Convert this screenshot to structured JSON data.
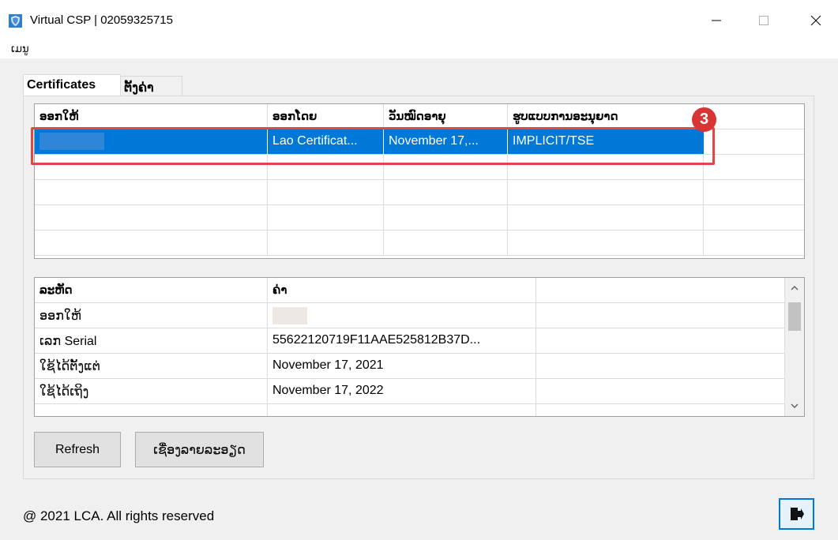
{
  "window": {
    "title": "Virtual CSP | 02059325715",
    "minimize_icon": "minimize-icon",
    "maximize_icon": "maximize-icon",
    "close_icon": "close-icon"
  },
  "menu": {
    "items": [
      {
        "label": "ເມນູ"
      }
    ]
  },
  "tabs": [
    {
      "label": "Certificates",
      "active": true
    },
    {
      "label": "ຕັ້ງຄ່າ",
      "active": false
    }
  ],
  "certificates_table": {
    "columns": [
      "ອອກໃຫ້",
      "ອອກໂດຍ",
      "ວັນໝົດອາຍຸ",
      "ຮູບແບບການອະນຸຍາດ"
    ],
    "rows": [
      {
        "issued_to": "",
        "issued_by": "Lao Certificat...",
        "expires": "November 17,...",
        "license": "IMPLICIT/TSE",
        "selected": true
      }
    ],
    "annotation_badge": "3"
  },
  "details_table": {
    "columns": [
      "ລະຫັດ",
      "ຄ່າ"
    ],
    "rows": [
      {
        "key": "ອອກໃຫ້",
        "value": ""
      },
      {
        "key": "ເລກ Serial",
        "value": "55622120719F11AAE525812B37D..."
      },
      {
        "key": "ໃຊ້ໄດ້ຕັ້ງແຕ່",
        "value": "November 17, 2021"
      },
      {
        "key": "ໃຊ້ໄດ້ເຖິງ",
        "value": "November 17, 2022"
      }
    ]
  },
  "buttons": {
    "refresh": "Refresh",
    "details": "ເຊື່ອງລາຍລະອຽດ"
  },
  "footer": {
    "copyright": "@ 2021 LCA. All rights reserved",
    "exit_icon": "exit-door-icon"
  },
  "colors": {
    "selection": "#0078d7",
    "annotation": "#e64545",
    "badge": "#d83434"
  }
}
